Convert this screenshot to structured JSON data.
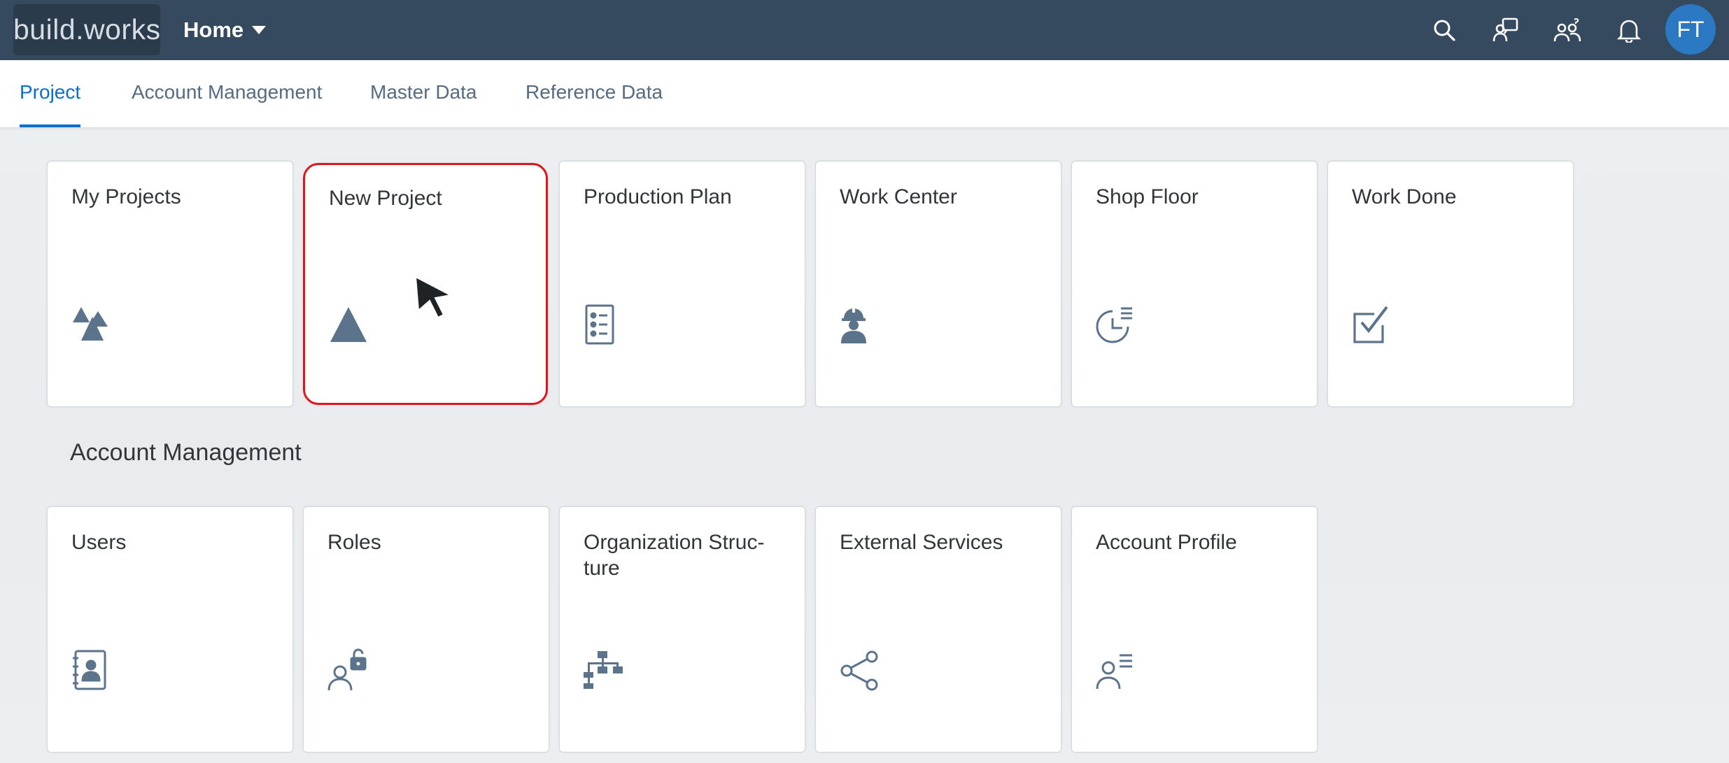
{
  "shell": {
    "logo_text": "build.works",
    "home_label": "Home",
    "icons": [
      "search-icon",
      "feedback-icon",
      "people-icon",
      "notification-bell-icon"
    ],
    "avatar_initials": "FT",
    "colors": {
      "shell_bg": "#354a5f",
      "avatar_bg": "#2b79c2",
      "accent": "#0a6ed1"
    }
  },
  "tabs": [
    {
      "label": "Project",
      "active": true
    },
    {
      "label": "Account Management",
      "active": false
    },
    {
      "label": "Master Data",
      "active": false
    },
    {
      "label": "Reference Data",
      "active": false
    }
  ],
  "project_tiles": [
    {
      "title": "My Projects",
      "icon": "mountains-icon"
    },
    {
      "title": "New Project",
      "icon": "triangle-icon",
      "highlighted": true
    },
    {
      "title": "Production Plan",
      "icon": "checklist-icon"
    },
    {
      "title": "Work Center",
      "icon": "worker-icon"
    },
    {
      "title": "Shop Floor",
      "icon": "pie-list-icon"
    },
    {
      "title": "Work Done",
      "icon": "checkbox-icon"
    }
  ],
  "account_section": {
    "title": "Account Management",
    "tiles": [
      {
        "title": "Users",
        "icon": "address-book-icon"
      },
      {
        "title": "Roles",
        "icon": "user-lock-icon"
      },
      {
        "title": "Organization Struc-ture",
        "icon": "org-chart-icon"
      },
      {
        "title": "External Services",
        "icon": "share-icon"
      },
      {
        "title": "Account Profile",
        "icon": "user-details-icon"
      }
    ]
  },
  "tile_icon_color": "#5b738b",
  "highlight_color": "#e0161e"
}
